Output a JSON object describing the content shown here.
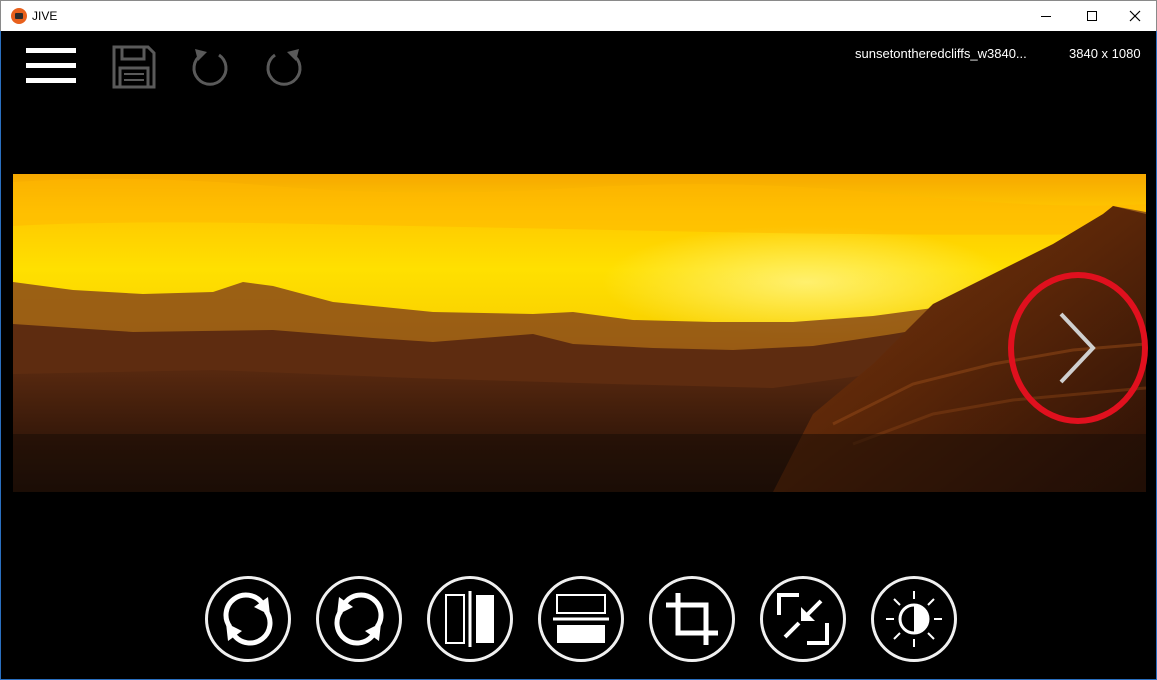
{
  "window": {
    "title": "JIVE",
    "controls": [
      "minimize",
      "maximize",
      "close"
    ]
  },
  "toolbar": {
    "items": [
      {
        "name": "menu",
        "icon": "hamburger-menu-icon",
        "enabled": true
      },
      {
        "name": "save",
        "icon": "floppy-disk-icon",
        "enabled": false
      },
      {
        "name": "undo",
        "icon": "undo-icon",
        "enabled": false
      },
      {
        "name": "redo",
        "icon": "redo-icon",
        "enabled": false
      }
    ]
  },
  "image_info": {
    "filename": "sunsetontheredcliffs_w3840...",
    "dimensions": "3840 x 1080"
  },
  "viewer": {
    "next_button_icon": "chevron-right-icon",
    "highlight_color": "#e0101e"
  },
  "edit_tools": [
    {
      "name": "rotate-clockwise",
      "icon": "rotate-clockwise-icon"
    },
    {
      "name": "rotate-counterclockwise",
      "icon": "rotate-counterclockwise-icon"
    },
    {
      "name": "flip-horizontal",
      "icon": "flip-horizontal-icon"
    },
    {
      "name": "flip-vertical",
      "icon": "flip-vertical-icon"
    },
    {
      "name": "crop",
      "icon": "crop-icon"
    },
    {
      "name": "resize",
      "icon": "resize-icon"
    },
    {
      "name": "brightness",
      "icon": "brightness-icon"
    }
  ],
  "colors": {
    "background": "#000000",
    "accent": "#ffffff",
    "disabled": "#5a5a5a"
  }
}
